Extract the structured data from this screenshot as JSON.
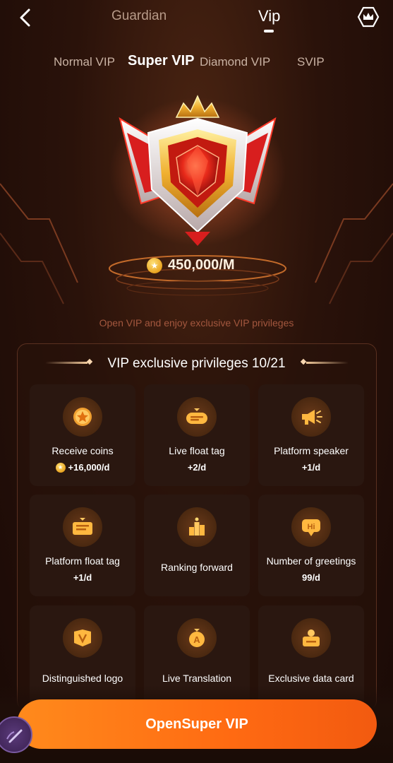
{
  "header": {
    "back_icon": "chevron-left-icon",
    "tab_guardian": "Guardian",
    "tab_vip": "Vip",
    "crown_icon": "crown-icon"
  },
  "level_tabs": [
    {
      "label": "Normal VIP",
      "active": false
    },
    {
      "label": "Super VIP",
      "active": true
    },
    {
      "label": "Diamond VIP",
      "active": false
    },
    {
      "label": "SVIP",
      "active": false
    }
  ],
  "badge": {
    "icon": "super-vip-badge-icon"
  },
  "price": {
    "text": "450,000/M",
    "coin_icon": "coin-icon"
  },
  "subtitle": "Open VIP and enjoy exclusive VIP privileges",
  "privileges": {
    "title": "VIP exclusive privileges 10/21",
    "items": [
      {
        "name": "Receive coins",
        "value": "+16,000/d",
        "icon": "star-coin-icon",
        "has_coin": true
      },
      {
        "name": "Live float tag",
        "value": "+2/d",
        "icon": "float-tag-icon",
        "has_coin": false
      },
      {
        "name": "Platform speaker",
        "value": "+1/d",
        "icon": "megaphone-icon",
        "has_coin": false
      },
      {
        "name": "Platform float tag",
        "value": "+1/d",
        "icon": "banner-icon",
        "has_coin": false
      },
      {
        "name": "Ranking forward",
        "value": "",
        "icon": "podium-icon",
        "has_coin": false
      },
      {
        "name": "Number of greetings",
        "value": "99/d",
        "icon": "hi-bubble-icon",
        "has_coin": false
      },
      {
        "name": "Distinguished logo",
        "value": "",
        "icon": "v-logo-icon",
        "has_coin": false
      },
      {
        "name": "Live Translation",
        "value": "",
        "icon": "translate-icon",
        "has_coin": false
      },
      {
        "name": "Exclusive data card",
        "value": "",
        "icon": "data-card-icon",
        "has_coin": false
      }
    ]
  },
  "cta": {
    "label": "OpenSuper VIP"
  },
  "colors": {
    "accent": "#ff7a18",
    "gold": "#f0b040",
    "background": "#2a120a"
  }
}
